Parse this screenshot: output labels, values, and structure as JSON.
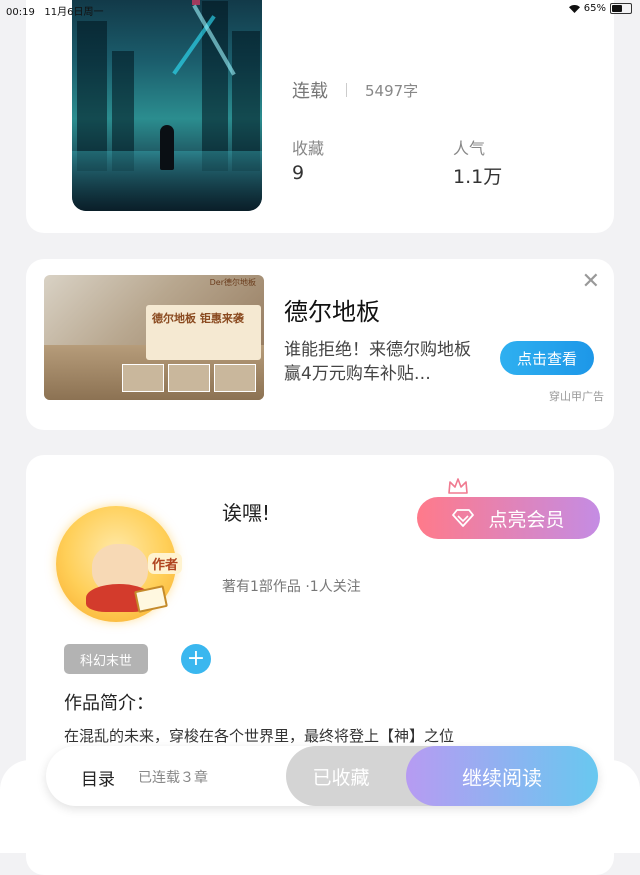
{
  "status_bar": {
    "time": "00:19",
    "date": "11月6日周一",
    "battery": "65%",
    "battery_level": 0.65
  },
  "book": {
    "status": "连载",
    "word_count": "5497字",
    "stats": [
      {
        "label": "收藏",
        "value": "9"
      },
      {
        "label": "人气",
        "value": "1.1万"
      }
    ]
  },
  "ad": {
    "image_banner_title": "德尔地板 钜惠来袭",
    "image_brand": "Der德尔地板",
    "title": "德尔地板",
    "description": "谁能拒绝！来德尔购地板赢4万元购车补贴…",
    "button_label": "点击查看",
    "source": "穿山甲广告",
    "close_icon": "close-icon"
  },
  "author": {
    "badge": "作者",
    "name": "诶嘿!",
    "stats": "著有1部作品 ·1人关注",
    "vip_button_label": "点亮会员",
    "genre_tag": "科幻末世",
    "add_tag_symbol": "+",
    "intro_title": "作品简介：",
    "intro_text": "在混乱的未来，穿梭在各个世界里，最终将登上【神】之位"
  },
  "bottom_bar": {
    "toc_label": "目录",
    "chapter_count": "已连载３章",
    "favorited_label": "已收藏",
    "continue_label": "继续阅读"
  }
}
